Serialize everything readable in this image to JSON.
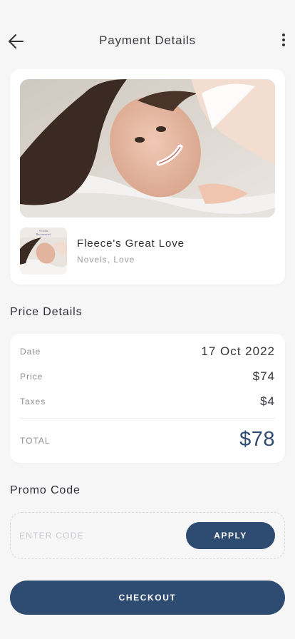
{
  "header": {
    "title": "Payment Details"
  },
  "book": {
    "title": "Fleece's Great Love",
    "genre": "Novels, Love"
  },
  "price_details": {
    "section_title": "Price Details",
    "date_label": "Date",
    "date_value": "17 Oct 2022",
    "price_label": "Price",
    "price_value": "$74",
    "taxes_label": "Taxes",
    "taxes_value": "$4",
    "total_label": "TOTAL",
    "total_value": "$78"
  },
  "promo": {
    "section_title": "Promo Code",
    "placeholder": "ENTER CODE",
    "value": "",
    "apply_label": "APPLY"
  },
  "checkout": {
    "label": "CHECKOUT"
  },
  "colors": {
    "accent": "#2e4b72",
    "background": "#f6f6f6",
    "card": "#ffffff"
  },
  "icons": {
    "back": "arrow-left-icon",
    "more": "more-vertical-icon"
  }
}
